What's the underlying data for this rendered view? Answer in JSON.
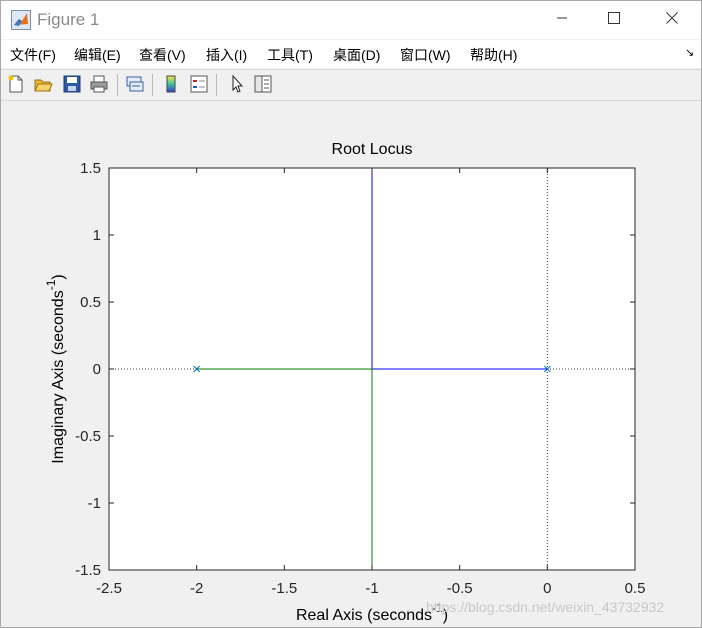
{
  "window": {
    "title": "Figure 1",
    "icon": "matlab-icon",
    "controls": [
      "minimize-icon",
      "maximize-icon",
      "close-icon"
    ]
  },
  "menu": [
    "文件(F)",
    "编辑(E)",
    "查看(V)",
    "插入(I)",
    "工具(T)",
    "桌面(D)",
    "窗口(W)",
    "帮助(H)"
  ],
  "menu_overflow_icon": "dock-arrow-icon",
  "toolbar": [
    "new-figure-icon",
    "open-file-icon",
    "save-icon",
    "print-icon",
    "link-plot-icon",
    "insert-colorbar-icon",
    "insert-legend-icon",
    "edit-plot-pointer-icon",
    "property-inspector-icon"
  ],
  "watermark": "https://blog.csdn.net/weixin_43732932",
  "chart_data": {
    "type": "line",
    "title": "Root Locus",
    "xlabel": "Real Axis (seconds",
    "ylabel": "Imaginary Axis (seconds",
    "unit_exponent": "-1",
    "label_close": ")",
    "xlim": [
      -2.5,
      0.5
    ],
    "ylim": [
      -1.5,
      1.5
    ],
    "xticks": [
      "-2.5",
      "-2",
      "-1.5",
      "-1",
      "-0.5",
      "0",
      "0.5"
    ],
    "yticks": [
      "1.5",
      "1",
      "0.5",
      "0",
      "-0.5",
      "-1",
      "-1.5"
    ],
    "grid": false,
    "colors": {
      "branch1": "#0000ff",
      "branch2": "#008000",
      "guide": "#404040",
      "pole": "#0072bd"
    },
    "series": [
      {
        "x": [
          0,
          -1,
          -1
        ],
        "y": [
          0,
          0,
          1.5
        ],
        "color": "#0000ff"
      },
      {
        "x": [
          -2,
          -1,
          -1
        ],
        "y": [
          0,
          0,
          -1.5
        ],
        "color": "#008000"
      }
    ],
    "poles": [
      {
        "x": -2,
        "y": 0
      },
      {
        "x": 0,
        "y": 0
      }
    ],
    "guides": {
      "vertical_x": 0,
      "horizontal_y": 0
    }
  }
}
